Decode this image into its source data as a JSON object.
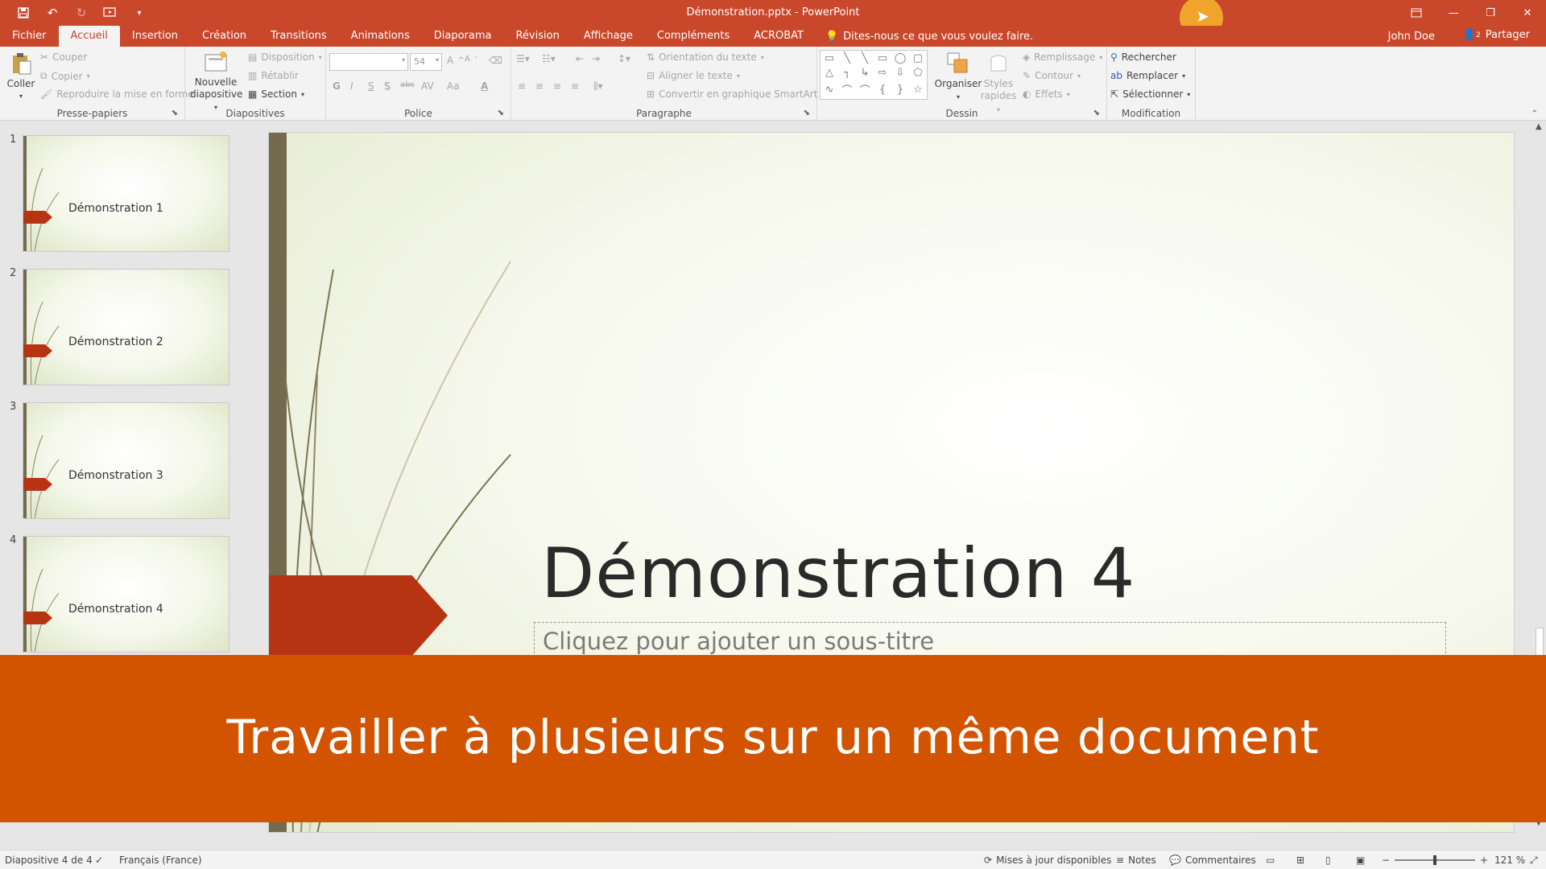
{
  "window": {
    "title": "Démonstration.pptx - PowerPoint",
    "controls": [
      "ribbon-display-icon",
      "minimize-icon",
      "restore-icon",
      "close-icon"
    ]
  },
  "qat": [
    "save-icon",
    "undo-icon",
    "redo-icon",
    "start-from-beginning-icon",
    "customize-icon"
  ],
  "tabs": [
    "Fichier",
    "Accueil",
    "Insertion",
    "Création",
    "Transitions",
    "Animations",
    "Diaporama",
    "Révision",
    "Affichage",
    "Compléments",
    "ACROBAT"
  ],
  "active_tab": "Accueil",
  "tellme": "Dites-nous ce que vous voulez faire.",
  "user": "John Doe",
  "share": "Partager",
  "share_count": "2",
  "ribbon": {
    "clipboard": {
      "label": "Presse-papiers",
      "paste": "Coller",
      "cut": "Couper",
      "copy": "Copier",
      "format_painter": "Reproduire la mise en forme"
    },
    "slides": {
      "label": "Diapositives",
      "new_slide_1": "Nouvelle",
      "new_slide_2": "diapositive",
      "layout": "Disposition",
      "reset": "Rétablir",
      "section": "Section"
    },
    "font": {
      "label": "Police",
      "size": "54",
      "bold": "G",
      "italic": "I",
      "underline": "S",
      "shadow": "S",
      "strike": "abc",
      "spacing": "AV",
      "case": "Aa",
      "color": "A"
    },
    "paragraph": {
      "label": "Paragraphe",
      "text_direction": "Orientation du texte",
      "align_text": "Aligner le texte",
      "smartart": "Convertir en graphique SmartArt"
    },
    "drawing": {
      "label": "Dessin",
      "arrange": "Organiser",
      "quick_styles_1": "Styles",
      "quick_styles_2": "rapides",
      "fill": "Remplissage",
      "outline": "Contour",
      "effects": "Effets"
    },
    "editing": {
      "label": "Modification",
      "find": "Rechercher",
      "replace": "Remplacer",
      "select": "Sélectionner"
    }
  },
  "thumbnails": [
    {
      "num": "1",
      "title": "Démonstration 1"
    },
    {
      "num": "2",
      "title": "Démonstration 2"
    },
    {
      "num": "3",
      "title": "Démonstration 3"
    },
    {
      "num": "4",
      "title": "Démonstration 4"
    }
  ],
  "slide": {
    "title": "Démonstration 4",
    "subtitle_placeholder": "Cliquez pour ajouter un sous-titre"
  },
  "banner": "Travailler à plusieurs sur un même document",
  "status": {
    "slide_info": "Diapositive 4 de 4",
    "language": "Français (France)",
    "updates": "Mises à jour disponibles",
    "notes": "Notes",
    "comments": "Commentaires",
    "zoom": "121 %"
  },
  "colors": {
    "accent": "#c9472a",
    "banner": "#d35400",
    "arrow": "#b73413"
  }
}
